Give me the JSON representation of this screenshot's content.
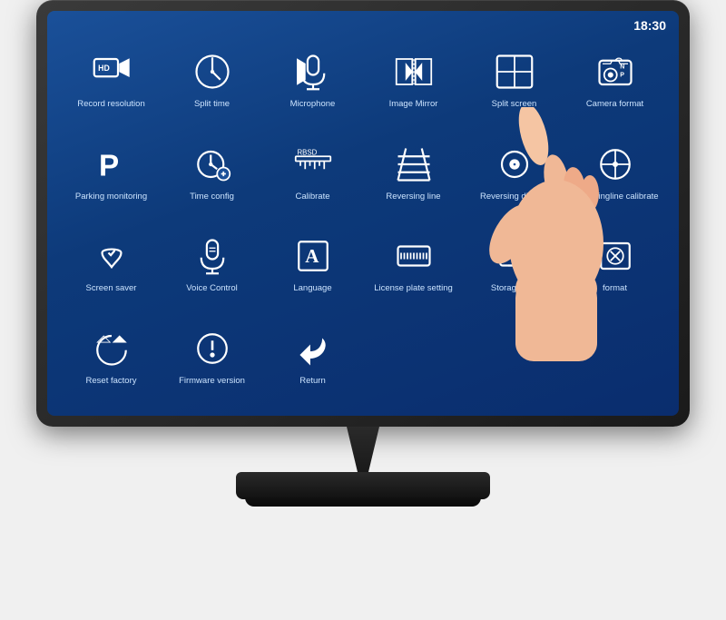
{
  "time": "18:30",
  "menu": {
    "items": [
      {
        "id": "record-resolution",
        "label": "Record resolution",
        "icon": "record-resolution"
      },
      {
        "id": "split-time",
        "label": "Split time",
        "icon": "split-time"
      },
      {
        "id": "microphone",
        "label": "Microphone",
        "icon": "microphone"
      },
      {
        "id": "image-mirror",
        "label": "Image Mirror",
        "icon": "image-mirror"
      },
      {
        "id": "split-screen",
        "label": "Split screen",
        "icon": "split-screen"
      },
      {
        "id": "camera-format",
        "label": "Camera format",
        "icon": "camera-format"
      },
      {
        "id": "parking-monitoring",
        "label": "Parking monitoring",
        "icon": "parking-monitoring"
      },
      {
        "id": "time-config",
        "label": "Time config",
        "icon": "time-config"
      },
      {
        "id": "calibrate",
        "label": "Calibrate",
        "icon": "calibrate"
      },
      {
        "id": "reversing-line",
        "label": "Reversing line",
        "icon": "reversing-line"
      },
      {
        "id": "reversing-display",
        "label": "Reversing display",
        "icon": "reversing-display"
      },
      {
        "id": "reversingline-calibrate",
        "label": "Reversingline calibrate",
        "icon": "reversingline-calibrate"
      },
      {
        "id": "screen-saver",
        "label": "Screen saver",
        "icon": "screen-saver"
      },
      {
        "id": "voice-control",
        "label": "Voice Control",
        "icon": "voice-control"
      },
      {
        "id": "language",
        "label": "Language",
        "icon": "language"
      },
      {
        "id": "license-plate",
        "label": "License plate setting",
        "icon": "license-plate"
      },
      {
        "id": "storage-info",
        "label": "Storage info",
        "icon": "storage-info"
      },
      {
        "id": "format",
        "label": "format",
        "icon": "format"
      },
      {
        "id": "reset-factory",
        "label": "Reset factory",
        "icon": "reset-factory"
      },
      {
        "id": "firmware-version",
        "label": "Firmware version",
        "icon": "firmware-version"
      },
      {
        "id": "return",
        "label": "Return",
        "icon": "return"
      },
      {
        "id": "empty1",
        "label": "",
        "icon": ""
      },
      {
        "id": "empty2",
        "label": "",
        "icon": ""
      },
      {
        "id": "empty3",
        "label": "",
        "icon": ""
      }
    ]
  }
}
